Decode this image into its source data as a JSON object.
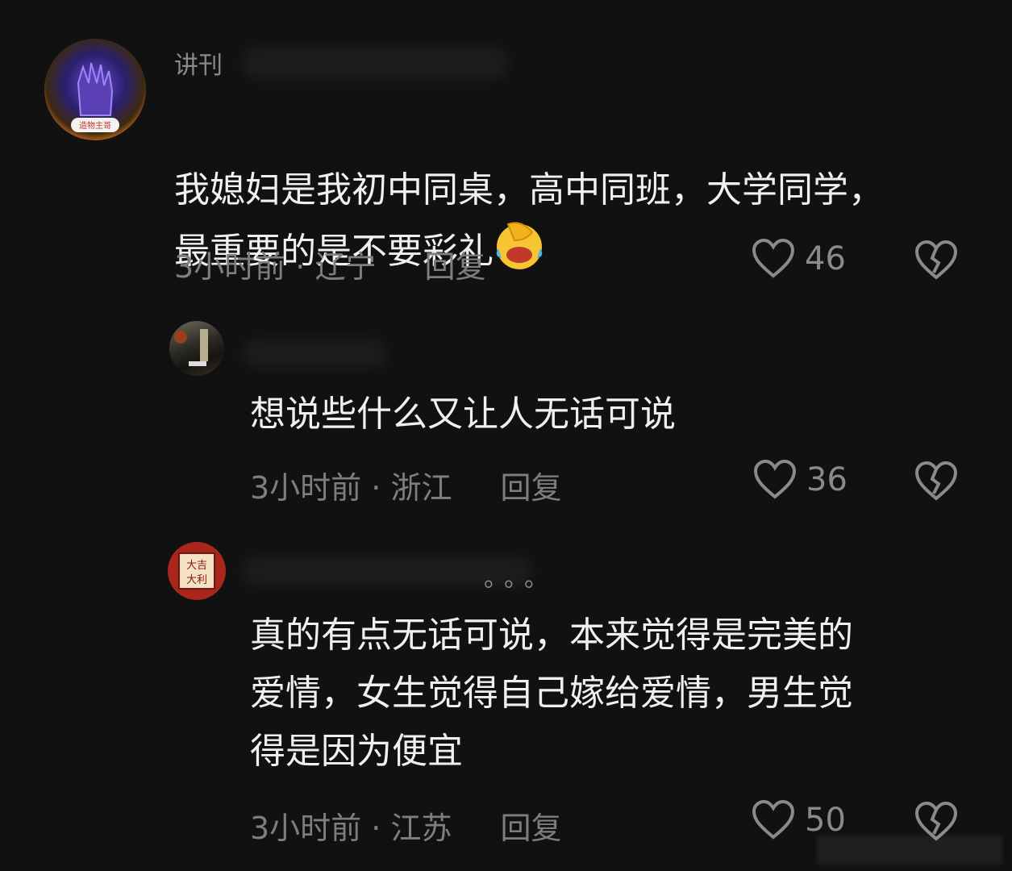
{
  "comments": [
    {
      "username": "讲刊",
      "avatar_badge": "造物主哥",
      "text": "我媳妇是我初中同桌，高中同班，大学同学，\n最重要的是不要彩礼",
      "emoji": "face-with-tears-of-joy-hand-over-eyes",
      "time": "3小时前",
      "region": "辽宁",
      "reply_label": "回复",
      "likes": "46"
    },
    {
      "username": "",
      "text": "想说些什么又让人无话可说",
      "time": "3小时前",
      "region": "浙江",
      "reply_label": "回复",
      "likes": "36"
    },
    {
      "username": "。。。",
      "avatar_text": "大吉大利",
      "text": "真的有点无话可说，本来觉得是完美的\n爱情，女生觉得自己嫁给爱情，男生觉\n得是因为便宜",
      "time": "3小时前",
      "region": "江苏",
      "reply_label": "回复",
      "likes": "50"
    }
  ],
  "separator": " · ",
  "colors": {
    "background": "#111112",
    "text": "#f0f0f0",
    "meta": "#7e7e7e"
  }
}
